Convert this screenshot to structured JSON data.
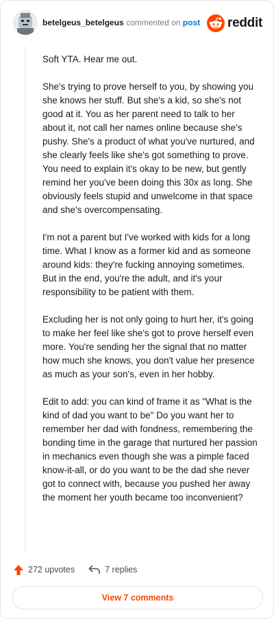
{
  "comment": {
    "username": "betelgeus_betelgeus",
    "commented_on_text": "commented on",
    "post_link": "post",
    "brand": "reddit",
    "paragraphs": [
      "Soft YTA. Hear me out.",
      "She's trying to prove herself to you, by showing you she knows her stuff. But she's a kid, so she's not good at it. You as her parent need to talk to her about it, not call her names online because she's pushy. She's a product of what you've nurtured, and she clearly feels like she's got something to prove. You need to explain it's okay to be new, but gently remind her you've been doing this 30x as long. She obviously feels stupid and unwelcome in that space and she's overcompensating.",
      "I'm not a parent but I've worked with kids for a long time. What I know as a former kid and as someone around kids: they're fucking annoying sometimes. But in the end, you're the adult, and it's your responsibility to be patient with them.",
      "Excluding her is not only going to hurt her, it's going to make her feel like she's got to prove herself even more. You're sending her the signal that no matter how much she knows, you don't value her presence as much as your son's, even in her hobby.",
      "Edit to add: you can kind of frame it as \"What is the kind of dad you want to be\" Do you want her to remember her dad with fondness, remembering the bonding time in the garage that nurtured her passion in mechanics even though she was a pimple faced know-it-all, or do you want to be the dad she never got to connect with, because you pushed her away the moment her youth became too inconvenient?"
    ]
  },
  "actions": {
    "upvotes": "272 upvotes",
    "replies": "7 replies",
    "view_comments": "View 7 comments"
  },
  "icons": {
    "upvote": "upvote-arrow-icon",
    "reply": "reply-arrow-icon",
    "brand": "reddit-snoo-icon",
    "avatar": "user-avatar"
  },
  "colors": {
    "brand_orange": "#ff4500",
    "link_blue": "#0079d3",
    "muted": "#7c7c7c"
  }
}
